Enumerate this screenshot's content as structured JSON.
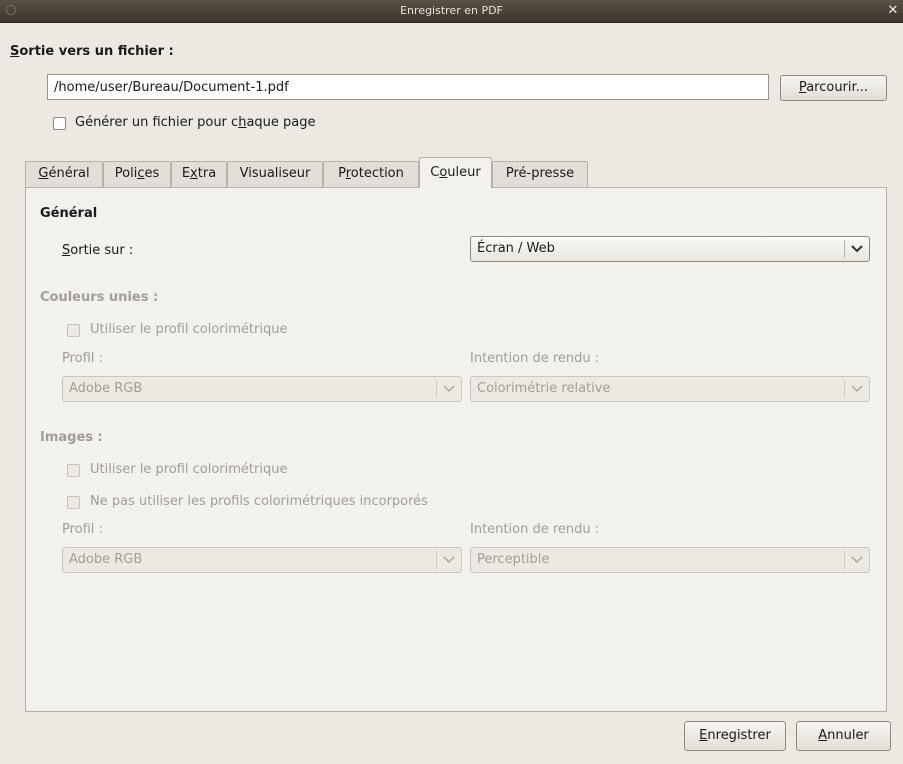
{
  "window": {
    "title": "Enregistrer en PDF"
  },
  "output": {
    "heading_first": "S",
    "heading_rest": "ortie vers un fichier :",
    "path_value": "/home/user/Bureau/Document-1.pdf",
    "browse_first": "P",
    "browse_rest": "arcourir...",
    "per_page_a": "Générer un fichier pour c",
    "per_page_u": "h",
    "per_page_b": "aque page"
  },
  "tabs": [
    {
      "a": "",
      "u": "G",
      "b": "énéral"
    },
    {
      "a": "Poli",
      "u": "c",
      "b": "es"
    },
    {
      "a": "E",
      "u": "x",
      "b": "tra"
    },
    {
      "a": "Visualiseur",
      "u": "",
      "b": ""
    },
    {
      "a": "P",
      "u": "r",
      "b": "otection"
    },
    {
      "a": "C",
      "u": "o",
      "b": "uleur"
    },
    {
      "a": "Pré-presse",
      "u": "",
      "b": ""
    }
  ],
  "color_tab": {
    "general_heading": "Général",
    "output_label_first": "S",
    "output_label_rest": "ortie sur :",
    "output_value": "Écran / Web",
    "solid": {
      "heading": "Couleurs unies :",
      "use_profile": "Utiliser le profil colorimétrique",
      "profile_label": "Profil :",
      "profile_value": "Adobe RGB",
      "intent_label": "Intention de rendu :",
      "intent_value": "Colorimétrie relative"
    },
    "images": {
      "heading": "Images :",
      "use_profile": "Utiliser le profil colorimétrique",
      "no_embedded": "Ne pas utiliser les profils colorimétriques incorporés",
      "profile_label": "Profil :",
      "profile_value": "Adobe RGB",
      "intent_label": "Intention de rendu :",
      "intent_value": "Perceptible"
    }
  },
  "footer": {
    "save_first": "E",
    "save_rest": "nregistrer",
    "cancel_first": "A",
    "cancel_rest": "nnuler"
  },
  "icons": {
    "window_menu": "circle-icon",
    "window_close": "close-icon",
    "dropdown": "chevron-down-icon"
  }
}
